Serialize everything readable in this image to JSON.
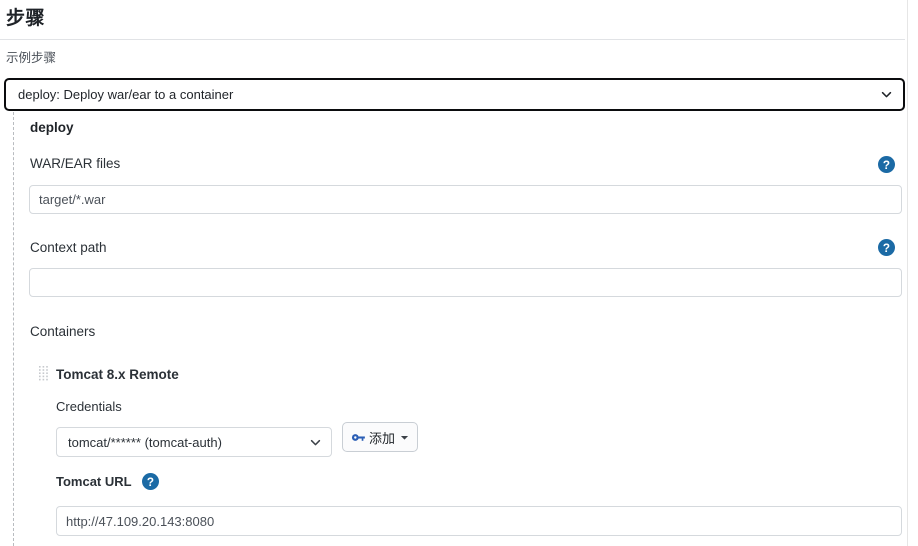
{
  "page": {
    "title": "步骤",
    "example_step_label": "示例步骤"
  },
  "step_selector": {
    "selected_value": "deploy: Deploy war/ear to a container",
    "caret_icon": "chevron-down-icon"
  },
  "step": {
    "heading": "deploy",
    "fields": [
      {
        "label": "WAR/EAR files",
        "value": "target/*.war",
        "help_icon": "help-circle-icon"
      },
      {
        "label": "Context path",
        "value": "",
        "help_icon": "help-circle-icon"
      }
    ],
    "containers_label": "Containers",
    "container": {
      "drag_handle_icon": "drag-handle-icon",
      "name": "Tomcat 8.x Remote",
      "credentials": {
        "label": "Credentials",
        "selected_value": "tomcat/****** (tomcat-auth)",
        "caret_icon": "chevron-down-icon",
        "add_button": {
          "label": "添加",
          "key_icon": "key-icon",
          "caret_icon": "caret-down-icon"
        }
      },
      "tomcat_url": {
        "label": "Tomcat URL",
        "help_icon": "help-circle-icon",
        "value": "http://47.109.20.143:8080"
      }
    }
  },
  "colors": {
    "help_blue": "#1b6aa5",
    "key_blue": "#2b5eb5",
    "focus_border": "#0b0c0e",
    "input_border": "#d5d9dd",
    "dashed_border": "#b9bcc0",
    "text": "#1f2328"
  }
}
